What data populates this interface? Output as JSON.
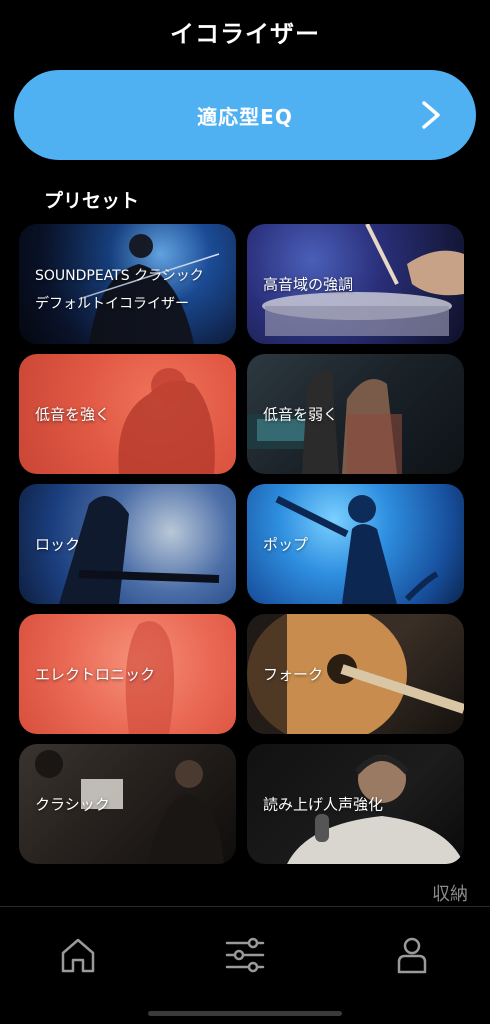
{
  "header": {
    "title": "イコライザー"
  },
  "adaptive_eq": {
    "label": "適応型EQ",
    "chevron_icon": "chevron-right-icon"
  },
  "presets": {
    "title": "プリセット",
    "items": [
      {
        "label": "SOUNDPEATS クラシック",
        "sublabel": "デフォルトイコライザー"
      },
      {
        "label": "高音域の強調"
      },
      {
        "label": "低音を強く"
      },
      {
        "label": "低音を弱く"
      },
      {
        "label": "ロック"
      },
      {
        "label": "ポップ"
      },
      {
        "label": "エレクトロニック"
      },
      {
        "label": "フォーク"
      },
      {
        "label": "クラシック"
      },
      {
        "label": "読み上げ人声強化"
      }
    ]
  },
  "collapse_label": "収納",
  "tabbar": {
    "icons": [
      "home-icon",
      "equalizer-icon",
      "profile-icon"
    ]
  },
  "colors": {
    "accent": "#4fb0f2",
    "background": "#000000",
    "muted_text": "#8a8a8a"
  }
}
